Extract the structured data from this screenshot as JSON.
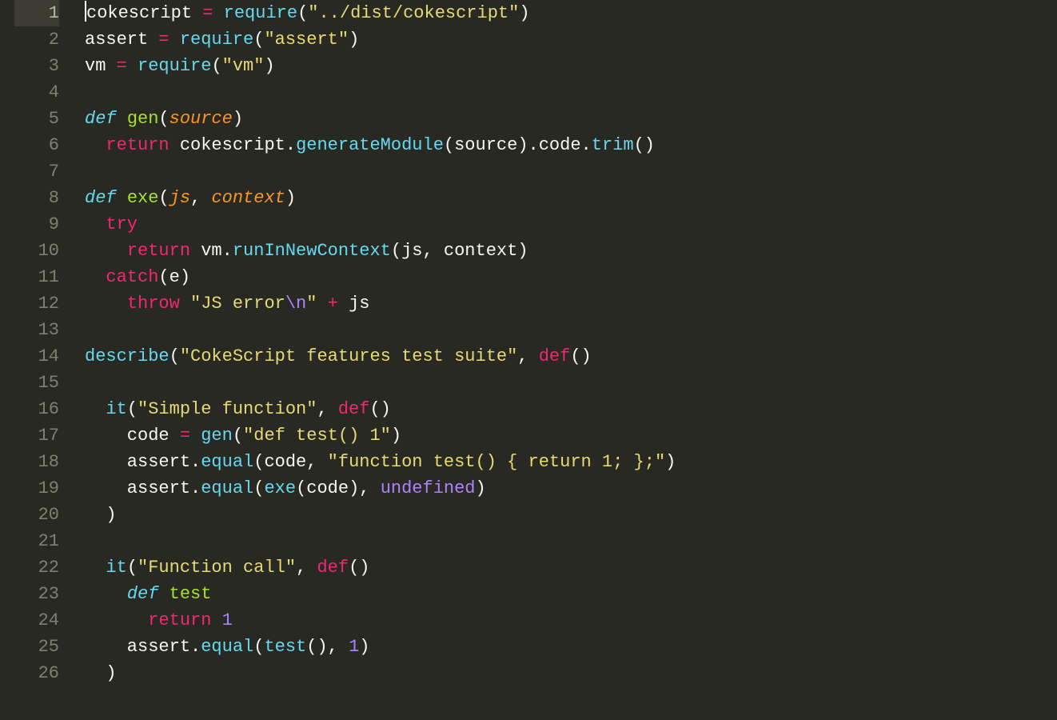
{
  "editor": {
    "active_line": 1,
    "line_numbers": [
      "1",
      "2",
      "3",
      "4",
      "5",
      "6",
      "7",
      "8",
      "9",
      "10",
      "11",
      "12",
      "13",
      "14",
      "15",
      "16",
      "17",
      "18",
      "19",
      "20",
      "21",
      "22",
      "23",
      "24",
      "25",
      "26"
    ],
    "lines": [
      {
        "tokens": [
          {
            "t": "cursor"
          },
          {
            "t": "ident",
            "v": "cokescript "
          },
          {
            "t": "op",
            "v": "="
          },
          {
            "t": "ident",
            "v": " "
          },
          {
            "t": "call",
            "v": "require"
          },
          {
            "t": "punc",
            "v": "("
          },
          {
            "t": "str",
            "v": "\"../dist/cokescript\""
          },
          {
            "t": "punc",
            "v": ")"
          }
        ]
      },
      {
        "tokens": [
          {
            "t": "ident",
            "v": "assert "
          },
          {
            "t": "op",
            "v": "="
          },
          {
            "t": "ident",
            "v": " "
          },
          {
            "t": "call",
            "v": "require"
          },
          {
            "t": "punc",
            "v": "("
          },
          {
            "t": "str",
            "v": "\"assert\""
          },
          {
            "t": "punc",
            "v": ")"
          }
        ]
      },
      {
        "tokens": [
          {
            "t": "ident",
            "v": "vm "
          },
          {
            "t": "op",
            "v": "="
          },
          {
            "t": "ident",
            "v": " "
          },
          {
            "t": "call",
            "v": "require"
          },
          {
            "t": "punc",
            "v": "("
          },
          {
            "t": "str",
            "v": "\"vm\""
          },
          {
            "t": "punc",
            "v": ")"
          }
        ]
      },
      {
        "tokens": []
      },
      {
        "tokens": [
          {
            "t": "def",
            "v": "def "
          },
          {
            "t": "func",
            "v": "gen"
          },
          {
            "t": "punc",
            "v": "("
          },
          {
            "t": "param",
            "v": "source"
          },
          {
            "t": "punc",
            "v": ")"
          }
        ]
      },
      {
        "tokens": [
          {
            "t": "ident",
            "v": "  "
          },
          {
            "t": "kw",
            "v": "return"
          },
          {
            "t": "ident",
            "v": " cokescript."
          },
          {
            "t": "call",
            "v": "generateModule"
          },
          {
            "t": "punc",
            "v": "("
          },
          {
            "t": "ident",
            "v": "source"
          },
          {
            "t": "punc",
            "v": ")"
          },
          {
            "t": "ident",
            "v": ".code."
          },
          {
            "t": "call",
            "v": "trim"
          },
          {
            "t": "punc",
            "v": "()"
          }
        ]
      },
      {
        "tokens": []
      },
      {
        "tokens": [
          {
            "t": "def",
            "v": "def "
          },
          {
            "t": "func",
            "v": "exe"
          },
          {
            "t": "punc",
            "v": "("
          },
          {
            "t": "param",
            "v": "js"
          },
          {
            "t": "punc",
            "v": ", "
          },
          {
            "t": "param",
            "v": "context"
          },
          {
            "t": "punc",
            "v": ")"
          }
        ]
      },
      {
        "tokens": [
          {
            "t": "ident",
            "v": "  "
          },
          {
            "t": "kw",
            "v": "try"
          }
        ]
      },
      {
        "tokens": [
          {
            "t": "ident",
            "v": "    "
          },
          {
            "t": "kw",
            "v": "return"
          },
          {
            "t": "ident",
            "v": " vm."
          },
          {
            "t": "call",
            "v": "runInNewContext"
          },
          {
            "t": "punc",
            "v": "("
          },
          {
            "t": "ident",
            "v": "js"
          },
          {
            "t": "punc",
            "v": ", "
          },
          {
            "t": "ident",
            "v": "context"
          },
          {
            "t": "punc",
            "v": ")"
          }
        ]
      },
      {
        "tokens": [
          {
            "t": "ident",
            "v": "  "
          },
          {
            "t": "kw",
            "v": "catch"
          },
          {
            "t": "punc",
            "v": "("
          },
          {
            "t": "ident",
            "v": "e"
          },
          {
            "t": "punc",
            "v": ")"
          }
        ]
      },
      {
        "tokens": [
          {
            "t": "ident",
            "v": "    "
          },
          {
            "t": "kw",
            "v": "throw"
          },
          {
            "t": "ident",
            "v": " "
          },
          {
            "t": "str",
            "v": "\"JS error"
          },
          {
            "t": "esc",
            "v": "\\n"
          },
          {
            "t": "str",
            "v": "\""
          },
          {
            "t": "ident",
            "v": " "
          },
          {
            "t": "op",
            "v": "+"
          },
          {
            "t": "ident",
            "v": " js"
          }
        ]
      },
      {
        "tokens": []
      },
      {
        "tokens": [
          {
            "t": "call",
            "v": "describe"
          },
          {
            "t": "punc",
            "v": "("
          },
          {
            "t": "str",
            "v": "\"CokeScript features test suite\""
          },
          {
            "t": "punc",
            "v": ", "
          },
          {
            "t": "kw",
            "v": "def"
          },
          {
            "t": "punc",
            "v": "()"
          }
        ]
      },
      {
        "tokens": []
      },
      {
        "tokens": [
          {
            "t": "ident",
            "v": "  "
          },
          {
            "t": "call",
            "v": "it"
          },
          {
            "t": "punc",
            "v": "("
          },
          {
            "t": "str",
            "v": "\"Simple function\""
          },
          {
            "t": "punc",
            "v": ", "
          },
          {
            "t": "kw",
            "v": "def"
          },
          {
            "t": "punc",
            "v": "()"
          }
        ]
      },
      {
        "tokens": [
          {
            "t": "ident",
            "v": "    code "
          },
          {
            "t": "op",
            "v": "="
          },
          {
            "t": "ident",
            "v": " "
          },
          {
            "t": "call",
            "v": "gen"
          },
          {
            "t": "punc",
            "v": "("
          },
          {
            "t": "str",
            "v": "\"def test() 1\""
          },
          {
            "t": "punc",
            "v": ")"
          }
        ]
      },
      {
        "tokens": [
          {
            "t": "ident",
            "v": "    assert."
          },
          {
            "t": "call",
            "v": "equal"
          },
          {
            "t": "punc",
            "v": "("
          },
          {
            "t": "ident",
            "v": "code"
          },
          {
            "t": "punc",
            "v": ", "
          },
          {
            "t": "str",
            "v": "\"function test() { return 1; };\""
          },
          {
            "t": "punc",
            "v": ")"
          }
        ]
      },
      {
        "tokens": [
          {
            "t": "ident",
            "v": "    assert."
          },
          {
            "t": "call",
            "v": "equal"
          },
          {
            "t": "punc",
            "v": "("
          },
          {
            "t": "call",
            "v": "exe"
          },
          {
            "t": "punc",
            "v": "("
          },
          {
            "t": "ident",
            "v": "code"
          },
          {
            "t": "punc",
            "v": "), "
          },
          {
            "t": "const",
            "v": "undefined"
          },
          {
            "t": "punc",
            "v": ")"
          }
        ]
      },
      {
        "tokens": [
          {
            "t": "ident",
            "v": "  "
          },
          {
            "t": "punc",
            "v": ")"
          }
        ]
      },
      {
        "tokens": []
      },
      {
        "tokens": [
          {
            "t": "ident",
            "v": "  "
          },
          {
            "t": "call",
            "v": "it"
          },
          {
            "t": "punc",
            "v": "("
          },
          {
            "t": "str",
            "v": "\"Function call\""
          },
          {
            "t": "punc",
            "v": ", "
          },
          {
            "t": "kw",
            "v": "def"
          },
          {
            "t": "punc",
            "v": "()"
          }
        ]
      },
      {
        "tokens": [
          {
            "t": "ident",
            "v": "    "
          },
          {
            "t": "def",
            "v": "def "
          },
          {
            "t": "func",
            "v": "test"
          }
        ]
      },
      {
        "tokens": [
          {
            "t": "ident",
            "v": "      "
          },
          {
            "t": "kw",
            "v": "return"
          },
          {
            "t": "ident",
            "v": " "
          },
          {
            "t": "num",
            "v": "1"
          }
        ]
      },
      {
        "tokens": [
          {
            "t": "ident",
            "v": "    assert."
          },
          {
            "t": "call",
            "v": "equal"
          },
          {
            "t": "punc",
            "v": "("
          },
          {
            "t": "call",
            "v": "test"
          },
          {
            "t": "punc",
            "v": "(), "
          },
          {
            "t": "num",
            "v": "1"
          },
          {
            "t": "punc",
            "v": ")"
          }
        ]
      },
      {
        "tokens": [
          {
            "t": "ident",
            "v": "  "
          },
          {
            "t": "punc",
            "v": ")"
          }
        ]
      }
    ]
  }
}
